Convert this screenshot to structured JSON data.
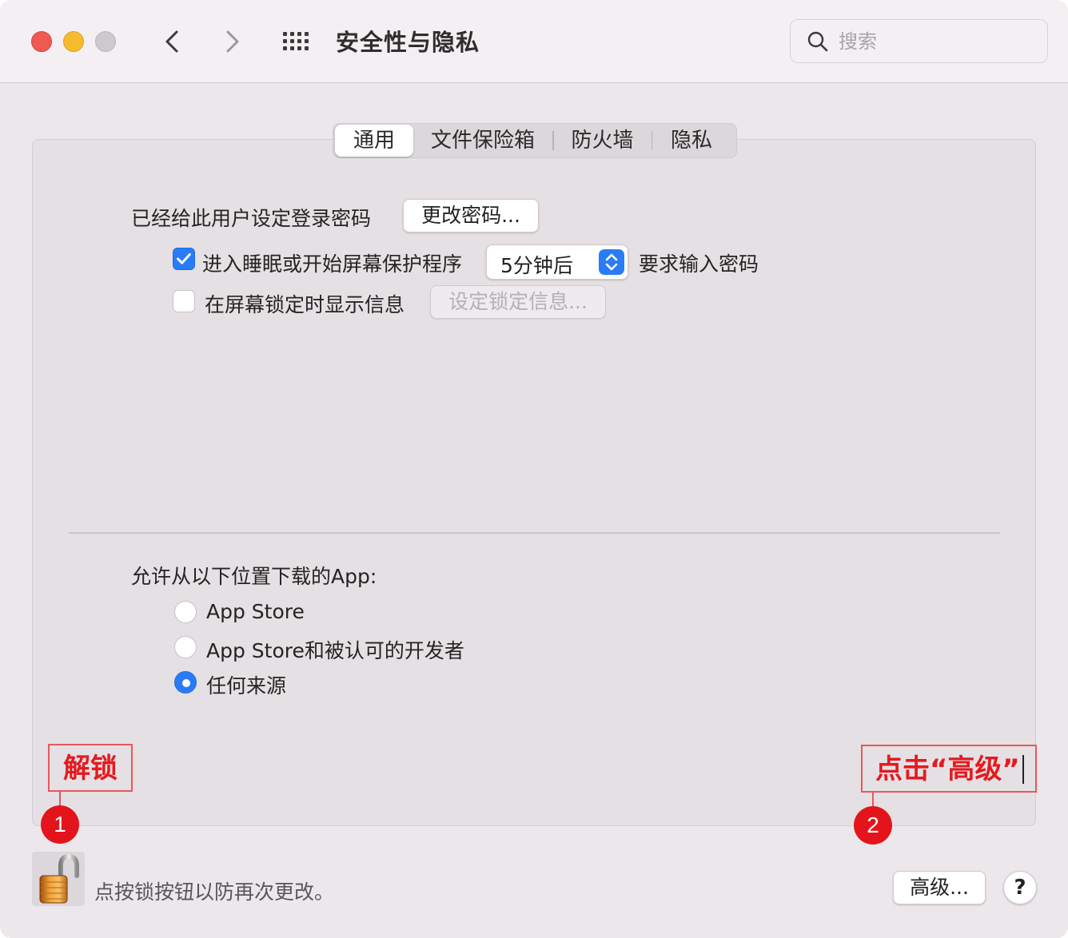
{
  "window": {
    "title": "安全性与隐私",
    "search_placeholder": "搜索"
  },
  "tabs": [
    {
      "label": "通用",
      "active": true
    },
    {
      "label": "文件保险箱",
      "active": false
    },
    {
      "label": "防火墙",
      "active": false
    },
    {
      "label": "隐私",
      "active": false
    }
  ],
  "general": {
    "password_set_label": "已经给此用户设定登录密码",
    "change_password_button": "更改密码...",
    "require_password": {
      "checked": true,
      "label": "进入睡眠或开始屏幕保护程序",
      "delay_value": "5分钟后",
      "suffix": "要求输入密码"
    },
    "show_message": {
      "checked": false,
      "label": "在屏幕锁定时显示信息",
      "button": "设定锁定信息..."
    },
    "allow_apps_label": "允许从以下位置下载的App:",
    "allow_options": [
      {
        "label": "App Store",
        "selected": false
      },
      {
        "label": "App Store和被认可的开发者",
        "selected": false
      },
      {
        "label": "任何来源",
        "selected": true
      }
    ]
  },
  "footer": {
    "lock_text": "点按锁按钮以防再次更改。",
    "advanced_button": "高级...",
    "help_button": "?"
  },
  "annotations": [
    {
      "number": "1",
      "text": "解锁"
    },
    {
      "number": "2",
      "text": "点击“高级”"
    }
  ],
  "colors": {
    "accent": "#2a7cf6",
    "annotation_red": "#e4141c"
  }
}
